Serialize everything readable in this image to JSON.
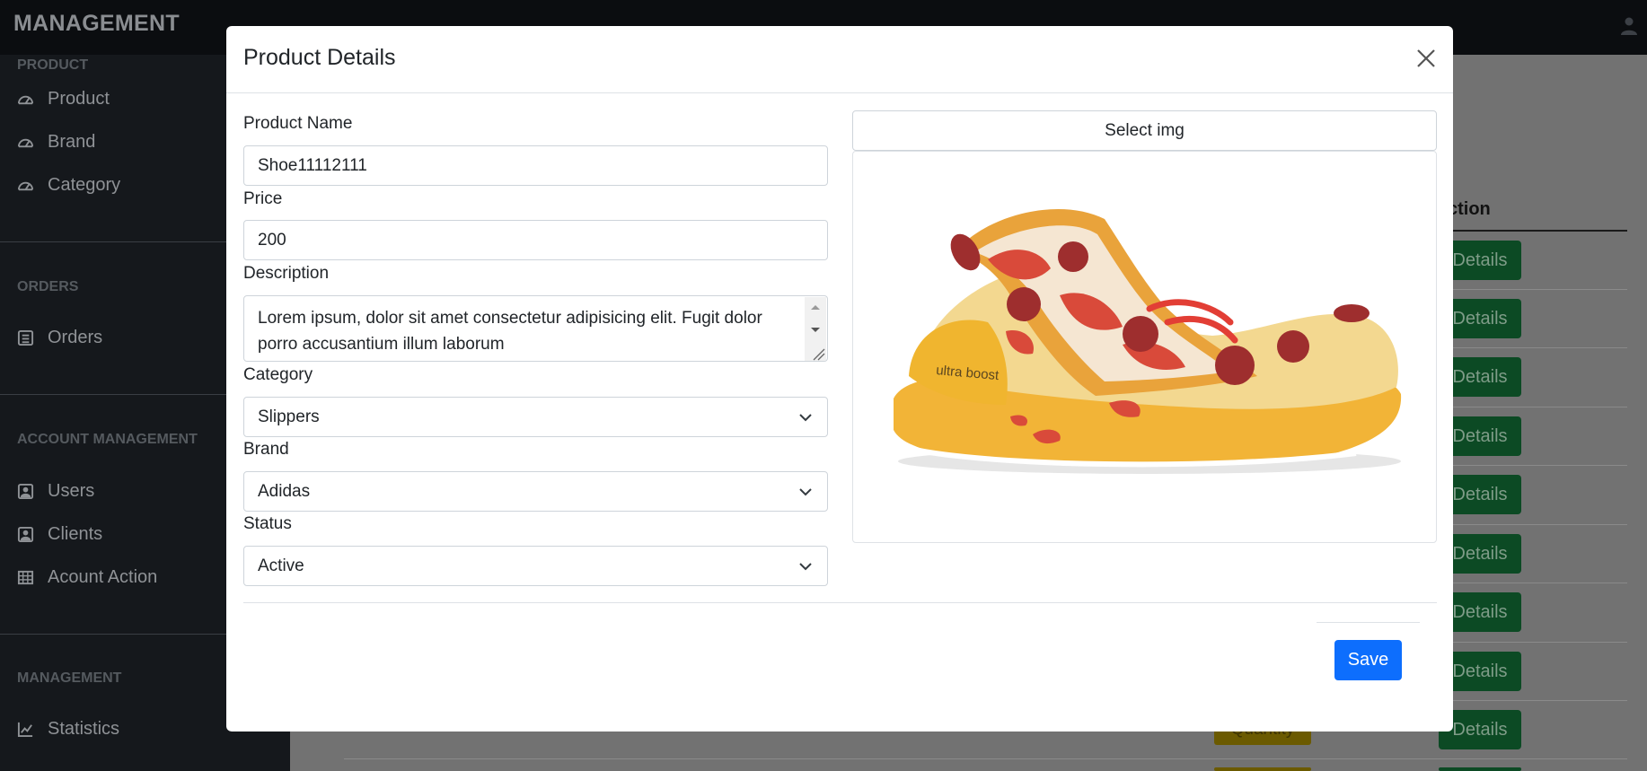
{
  "app": {
    "title": "MANAGEMENT"
  },
  "sidebar": {
    "sections": [
      {
        "heading": "PRODUCT",
        "items": [
          {
            "label": "Product",
            "icon": "dashboard-icon"
          },
          {
            "label": "Brand",
            "icon": "dashboard-icon"
          },
          {
            "label": "Category",
            "icon": "dashboard-icon"
          }
        ]
      },
      {
        "heading": "ORDERS",
        "items": [
          {
            "label": "Orders",
            "icon": "list-icon"
          }
        ]
      },
      {
        "heading": "ACCOUNT MANAGEMENT",
        "items": [
          {
            "label": "Users",
            "icon": "person-icon"
          },
          {
            "label": "Clients",
            "icon": "person-icon"
          },
          {
            "label": "Acount Action",
            "icon": "table-icon"
          }
        ]
      },
      {
        "heading": "MANAGEMENT",
        "items": [
          {
            "label": "Statistics",
            "icon": "chart-icon"
          }
        ]
      }
    ]
  },
  "background_table": {
    "action_header": "ction",
    "details_label": "Details",
    "quantity_label": "Quantity"
  },
  "modal": {
    "title": "Product Details",
    "fields": {
      "name_label": "Product Name",
      "name_value": "Shoe11112111",
      "price_label": "Price",
      "price_value": "200",
      "description_label": "Description",
      "description_value": "Lorem ipsum, dolor sit amet consectetur adipisicing elit. Fugit dolor porro accusantium illum laborum",
      "category_label": "Category",
      "category_value": "Slippers",
      "brand_label": "Brand",
      "brand_value": "Adidas",
      "status_label": "Status",
      "status_value": "Active"
    },
    "select_img_label": "Select img",
    "image_text": "ultra boost",
    "save_label": "Save"
  },
  "colors": {
    "primary": "#0d6efd",
    "success": "#198754",
    "sidebar_bg": "#212529"
  }
}
